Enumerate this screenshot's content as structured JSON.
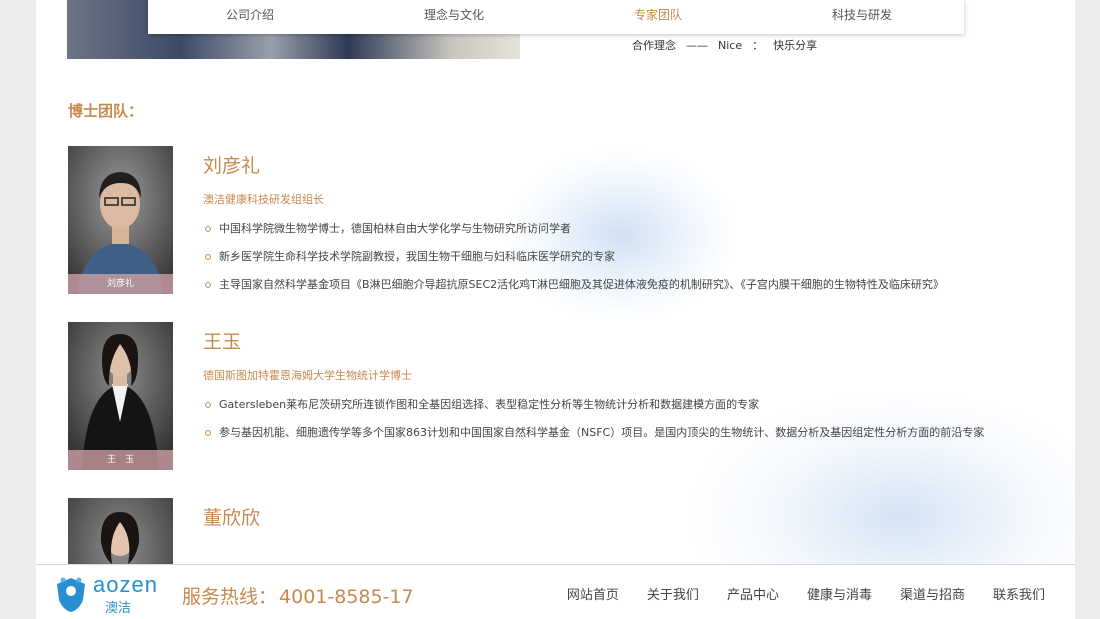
{
  "tabs": [
    {
      "label": "公司介绍",
      "active": false
    },
    {
      "label": "理念与文化",
      "active": false
    },
    {
      "label": "专家团队",
      "active": true
    },
    {
      "label": "科技与研发",
      "active": false
    }
  ],
  "motto": {
    "left": "合作理念",
    "dash": "——",
    "keyword": "Nice",
    "colon": "：",
    "right": "快乐分享"
  },
  "section_title": "博士团队：",
  "members": [
    {
      "name": "刘彦礼",
      "caption": "刘彦礼",
      "title": "澳洁健康科技研发组组长",
      "bullets": [
        "中国科学院微生物学博士，德国柏林自由大学化学与生物研究所访问学者",
        "新乡医学院生命科学技术学院副教授，我国生物干细胞与妇科临床医学研究的专家",
        "主导国家自然科学基金项目《B淋巴细胞介导超抗原SEC2活化鸡T淋巴细胞及其促进体液免疫的机制研究》、《子宫内膜干细胞的生物特性及临床研究》"
      ]
    },
    {
      "name": "王玉",
      "caption": "王　玉",
      "title": "德国斯图加特霍恩海姆大学生物统计学博士",
      "bullets": [
        "Gatersleben莱布尼茨研究所连锁作图和全基因组选择、表型稳定性分析等生物统计分析和数据建模方面的专家",
        "参与基因机能、细胞遗传学等多个国家863计划和中国国家自然科学基金（NSFC）项目。是国内顶尖的生物统计、数据分析及基因组定性分析方面的前沿专家"
      ]
    },
    {
      "name": "董欣欣",
      "caption": "",
      "title": "",
      "bullets": []
    }
  ],
  "footer": {
    "logo_text": "aozen",
    "logo_sub": "澳洁",
    "hotline_label": "服务热线：",
    "hotline_number": "4001-8585-17",
    "nav": [
      "网站首页",
      "关于我们",
      "产品中心",
      "健康与消毒",
      "渠道与招商",
      "联系我们"
    ]
  },
  "colors": {
    "accent": "#c8894f",
    "logo": "#2a8fd0"
  }
}
